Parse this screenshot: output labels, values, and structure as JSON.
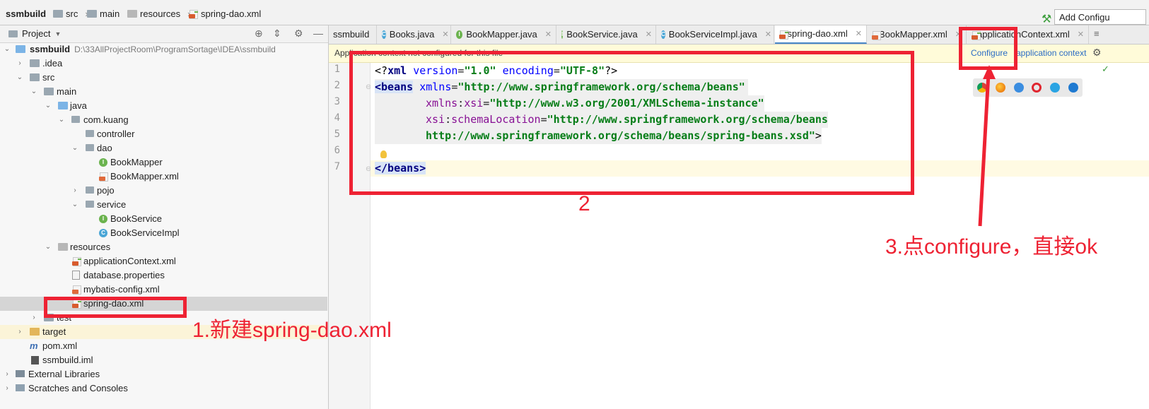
{
  "navbar": {
    "project": "ssmbuild",
    "src": "src",
    "main": "main",
    "resources": "resources",
    "file": "spring-dao.xml",
    "add_config": "Add Configu"
  },
  "panel": {
    "title": "Project"
  },
  "tree": [
    {
      "label": "ssmbuild",
      "sub": "D:\\33AllProjectRoom\\ProgramSortage\\IDEA\\ssmbuild"
    },
    {
      "label": ".idea"
    },
    {
      "label": "src"
    },
    {
      "label": "main"
    },
    {
      "label": "java"
    },
    {
      "label": "com.kuang"
    },
    {
      "label": "controller"
    },
    {
      "label": "dao"
    },
    {
      "label": "BookMapper"
    },
    {
      "label": "BookMapper.xml"
    },
    {
      "label": "pojo"
    },
    {
      "label": "service"
    },
    {
      "label": "BookService"
    },
    {
      "label": "BookServiceImpl"
    },
    {
      "label": "resources"
    },
    {
      "label": "applicationContext.xml"
    },
    {
      "label": "database.properties"
    },
    {
      "label": "mybatis-config.xml"
    },
    {
      "label": "spring-dao.xml"
    },
    {
      "label": "test"
    },
    {
      "label": "target"
    },
    {
      "label": "pom.xml"
    },
    {
      "label": "ssmbuild.iml"
    },
    {
      "label": "External Libraries"
    },
    {
      "label": "Scratches and Consoles"
    }
  ],
  "tabs": [
    {
      "label": "ssmbuild"
    },
    {
      "label": "Books.java"
    },
    {
      "label": "BookMapper.java"
    },
    {
      "label": "BookService.java"
    },
    {
      "label": "BookServiceImpl.java"
    },
    {
      "label": "spring-dao.xml"
    },
    {
      "label": "BookMapper.xml"
    },
    {
      "label": "applicationContext.xml"
    }
  ],
  "banner": {
    "message": "Application context not configured for this file",
    "link1": "Configure",
    "link2": "application context"
  },
  "code": {
    "line_numbers": [
      "1",
      "2",
      "3",
      "4",
      "5",
      "6",
      "7"
    ],
    "l1_open": "<?",
    "l1_tag": "xml",
    "l1_a1": "version",
    "l1_eq1": "=",
    "l1_v1": "\"1.0\"",
    "l1_a2": "encoding",
    "l1_eq2": "=",
    "l1_v2": "\"UTF-8\"",
    "l1_close": "?>",
    "l2_tag": "<beans",
    "l2_attr": "xmlns",
    "l2_eq": "=",
    "l2_val": "\"http://www.springframework.org/schema/beans\"",
    "l3_ns": "xmlns",
    "l3_colon": ":",
    "l3_attr": "xsi",
    "l3_eq": "=",
    "l3_val": "\"http://www.w3.org/2001/XMLSchema-instance\"",
    "l4_ns": "xsi",
    "l4_colon": ":",
    "l4_attr": "schemaLocation",
    "l4_eq": "=",
    "l4_val": "\"http://www.springframework.org/schema/beans",
    "l5_val": "http://www.springframework.org/schema/beans/spring-beans.xsd\"",
    "l5_close": ">",
    "l7_tag": "</beans>"
  },
  "annotations": {
    "step1": "1.新建spring-dao.xml",
    "step2": "2",
    "step3": "3.点configure，直接ok"
  },
  "colors": {
    "annotation_red": "#ee2233",
    "link_blue": "#2a6cc4",
    "banner_bg": "#fffbd9"
  }
}
